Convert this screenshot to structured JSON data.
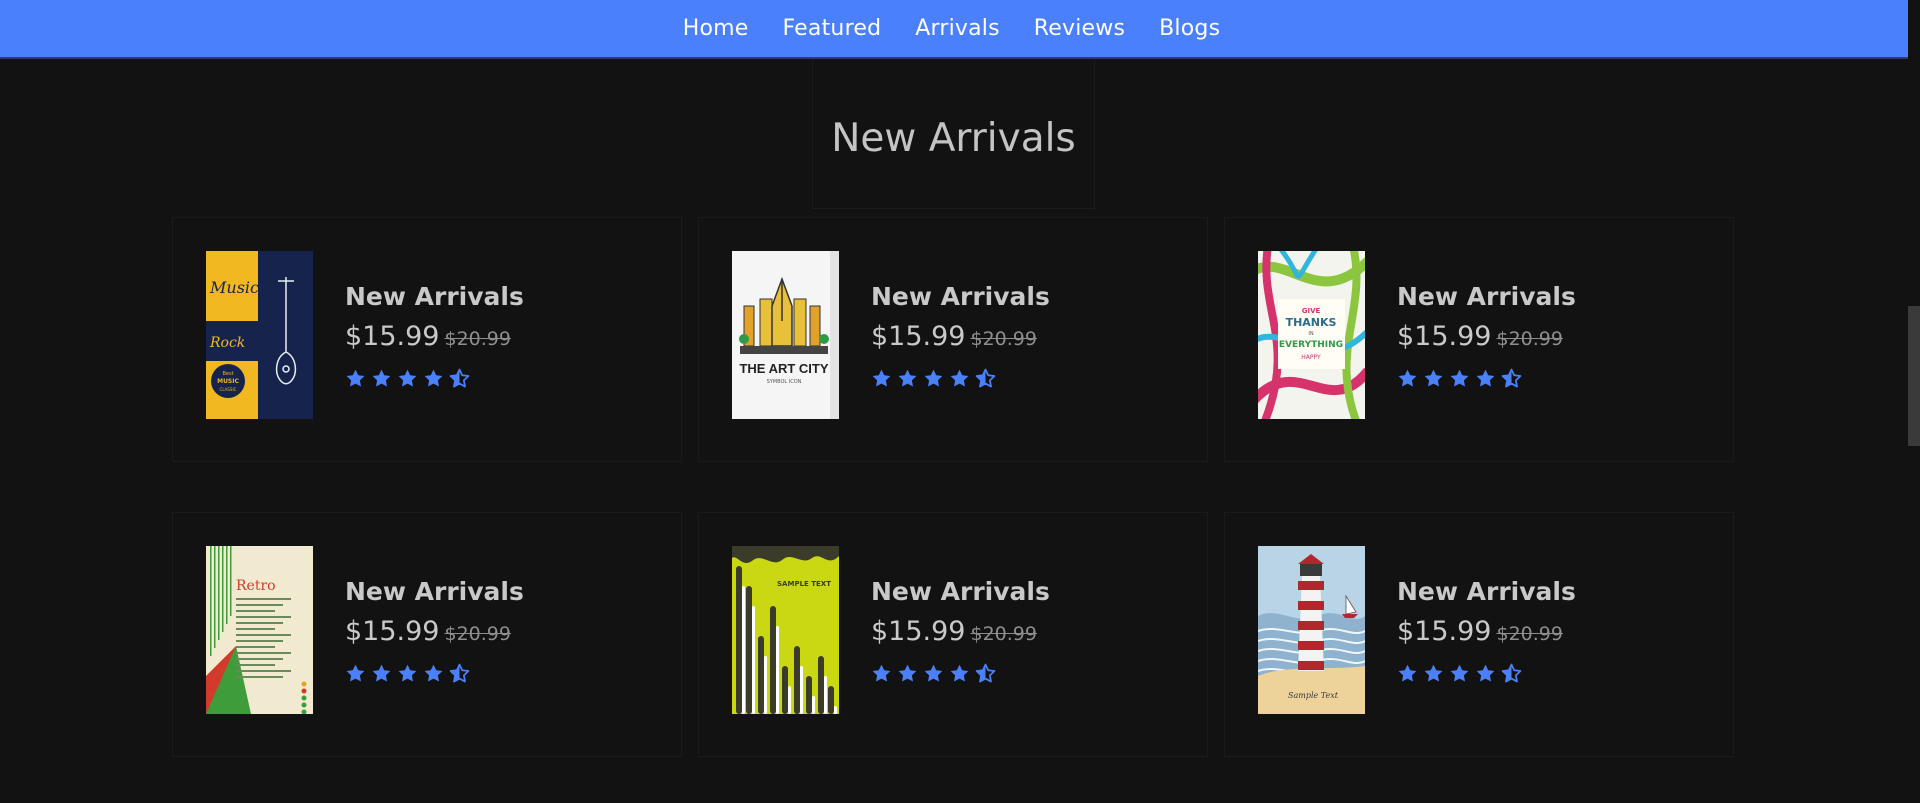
{
  "nav": {
    "items": [
      {
        "label": "Home"
      },
      {
        "label": "Featured"
      },
      {
        "label": "Arrivals"
      },
      {
        "label": "Reviews"
      },
      {
        "label": "Blogs"
      }
    ]
  },
  "section": {
    "title": "New Arrivals"
  },
  "colors": {
    "accent": "#4a80fb",
    "background": "#121212"
  },
  "products": [
    {
      "title": "New Arrivals",
      "price": "$15.99",
      "old_price": "$20.99",
      "rating": 4.5,
      "cover": "music"
    },
    {
      "title": "New Arrivals",
      "price": "$15.99",
      "old_price": "$20.99",
      "rating": 4.5,
      "cover": "art-city"
    },
    {
      "title": "New Arrivals",
      "price": "$15.99",
      "old_price": "$20.99",
      "rating": 4.5,
      "cover": "give-thanks"
    },
    {
      "title": "New Arrivals",
      "price": "$15.99",
      "old_price": "$20.99",
      "rating": 4.5,
      "cover": "retro"
    },
    {
      "title": "New Arrivals",
      "price": "$15.99",
      "old_price": "$20.99",
      "rating": 4.5,
      "cover": "sample-text"
    },
    {
      "title": "New Arrivals",
      "price": "$15.99",
      "old_price": "$20.99",
      "rating": 4.5,
      "cover": "lighthouse"
    }
  ],
  "covers": {
    "music": {
      "word1": "Music",
      "word2": "Rock",
      "badge": [
        "Best",
        "MUSIC",
        "CLASSIC"
      ]
    },
    "art-city": {
      "title": "THE ART CITY",
      "subtitle": "SYMBOL ICON"
    },
    "give-thanks": {
      "lines": [
        "GIVE",
        "THANKS",
        "IN",
        "EVERYTHING",
        "HAPPY"
      ]
    },
    "retro": {
      "title": "Retro"
    },
    "sample-text": {
      "title": "SAMPLE TEXT"
    },
    "lighthouse": {
      "caption": "Sample Text"
    }
  }
}
